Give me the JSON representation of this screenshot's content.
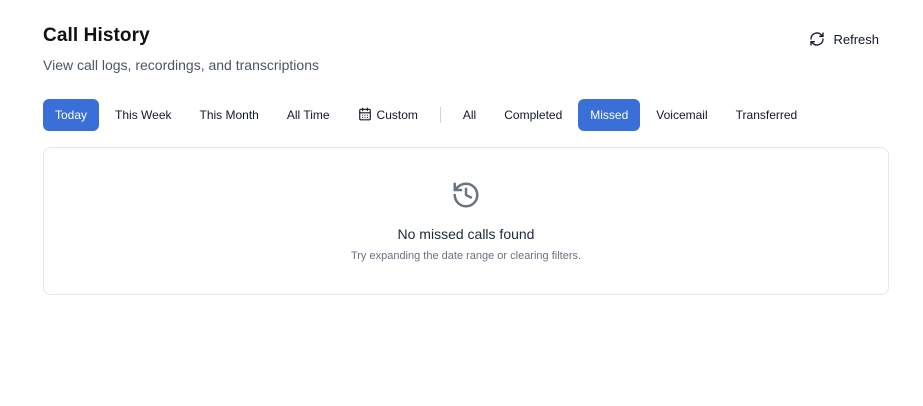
{
  "header": {
    "title": "Call History",
    "subtitle": "View call logs, recordings, and transcriptions",
    "refresh_label": "Refresh"
  },
  "date_filters": [
    {
      "label": "Today",
      "active": true
    },
    {
      "label": "This Week",
      "active": false
    },
    {
      "label": "This Month",
      "active": false
    },
    {
      "label": "All Time",
      "active": false
    },
    {
      "label": "Custom",
      "active": false,
      "icon": "calendar-icon"
    }
  ],
  "status_filters": [
    {
      "label": "All",
      "active": false
    },
    {
      "label": "Completed",
      "active": false
    },
    {
      "label": "Missed",
      "active": true
    },
    {
      "label": "Voicemail",
      "active": false
    },
    {
      "label": "Transferred",
      "active": false
    }
  ],
  "empty_state": {
    "icon": "history-icon",
    "title": "No missed calls found",
    "hint": "Try expanding the date range or clearing filters."
  },
  "colors": {
    "accent": "#3b6fd8",
    "card_border": "#e5e7eb",
    "muted_text": "#6b7280"
  }
}
